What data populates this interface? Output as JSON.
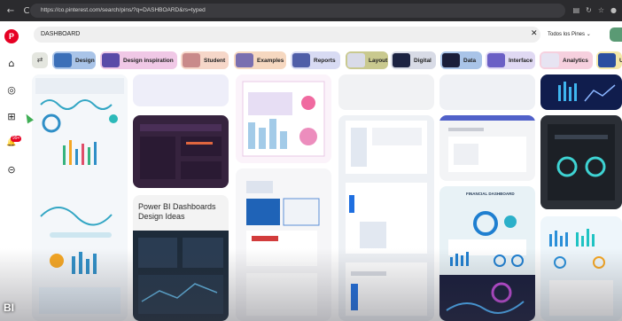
{
  "browser": {
    "url": "https://co.pinterest.com/search/pins/?q=DASHBOARD&rs=typed",
    "nav": {
      "back": "←",
      "reload": "C"
    },
    "toolbar_icons": [
      "page-icon",
      "refresh-icon",
      "star-icon",
      "profile-icon"
    ]
  },
  "sidebar": {
    "notification_badge": "99+",
    "items": [
      {
        "name": "pinterest-logo",
        "glyph": "P"
      },
      {
        "name": "home-icon",
        "glyph": "⌂"
      },
      {
        "name": "explore-icon",
        "glyph": "◎"
      },
      {
        "name": "create-icon",
        "glyph": "⊞"
      },
      {
        "name": "notifications-icon",
        "glyph": "🔔"
      },
      {
        "name": "messages-icon",
        "glyph": "⊝"
      }
    ]
  },
  "search": {
    "query": "DASHBOARD",
    "clear_glyph": "✕",
    "filter_label": "Todos los Pines",
    "filter_chevron": "⌄"
  },
  "chips": [
    {
      "label": "Design",
      "bg": "#a9c4e8",
      "thumb": "#3b6fb8"
    },
    {
      "label": "Design inspiration",
      "bg": "#f0c8e6",
      "thumb": "#5a4aa8"
    },
    {
      "label": "Student",
      "bg": "#f6d7c9",
      "thumb": "#c98a8a"
    },
    {
      "label": "Examples",
      "bg": "#f6d8c0",
      "thumb": "#7a6fb0"
    },
    {
      "label": "Reports",
      "bg": "#d8dbf3",
      "thumb": "#4f5ea8"
    },
    {
      "label": "Layout",
      "bg": "#c9c98f",
      "thumb": "#d9dbe8"
    },
    {
      "label": "Digital",
      "bg": "#d8dbe6",
      "thumb": "#1c2342"
    },
    {
      "label": "Data",
      "bg": "#a9c4e8",
      "thumb": "#1a1e3a"
    },
    {
      "label": "Interface",
      "bg": "#e0d9f3",
      "thumb": "#6b5fc5"
    },
    {
      "label": "Analytics",
      "bg": "#f6d0de",
      "thumb": "#e7e4f2"
    },
    {
      "label": "U",
      "bg": "#f3e7a8",
      "thumb": "#2b4fa0"
    }
  ],
  "pins": {
    "power_bi_title": "Power BI Dashboards Design Ideas",
    "financial_label": "FINANCIAL DASHBOARD"
  },
  "corner_label": "BI"
}
